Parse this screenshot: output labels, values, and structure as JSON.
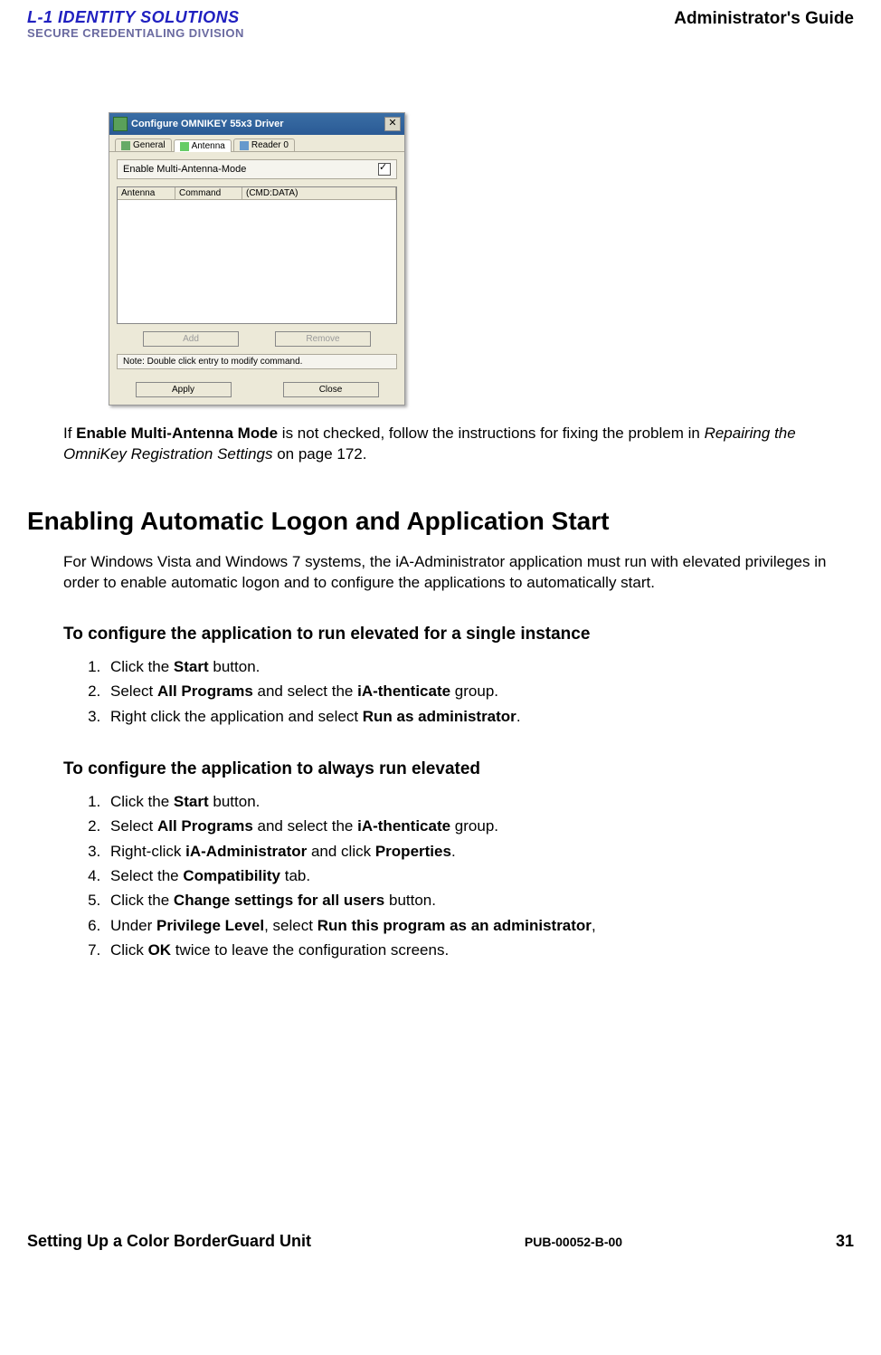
{
  "header": {
    "logo_line1": "L-1 IDENTITY SOLUTIONS",
    "logo_line2": "SECURE CREDENTIALING DIVISION",
    "guide_title": "Administrator's Guide"
  },
  "dialog": {
    "title": "Configure OMNIKEY 55x3 Driver",
    "tabs": {
      "general": "General",
      "antenna": "Antenna",
      "reader": "Reader 0"
    },
    "checkbox_label": "Enable Multi-Antenna-Mode",
    "cols": {
      "c1": "Antenna",
      "c2": "Command",
      "c3": "(CMD:DATA)"
    },
    "btn_add": "Add",
    "btn_remove": "Remove",
    "note": "Note: Double click entry to modify command.",
    "btn_apply": "Apply",
    "btn_close": "Close"
  },
  "para1_pre": "If ",
  "para1_bold": "Enable Multi-Antenna Mode",
  "para1_mid": " is not checked, follow the instructions for fixing the problem in ",
  "para1_italic": "Repairing the OmniKey Registration Settings",
  "para1_post": " on page 172.",
  "h1": "Enabling Automatic Logon and Application Start",
  "para2": "For Windows Vista and Windows 7 systems, the iA-Administrator application must run with elevated privileges in order to enable automatic logon and to configure the applications to automatically start.",
  "h2a": "To configure the application to run elevated for a single instance",
  "steps_a": {
    "s1_a": "Click the ",
    "s1_b": "Start",
    "s1_c": " button.",
    "s2_a": "Select ",
    "s2_b": "All Programs",
    "s2_c": " and select the ",
    "s2_d": "iA-thenticate",
    "s2_e": " group.",
    "s3_a": "Right click the application and select ",
    "s3_b": "Run as administrator",
    "s3_c": "."
  },
  "h2b": "To configure the application to always run elevated",
  "steps_b": {
    "s1_a": "Click the ",
    "s1_b": "Start",
    "s1_c": " button.",
    "s2_a": "Select ",
    "s2_b": "All Programs",
    "s2_c": " and select the ",
    "s2_d": "iA-thenticate",
    "s2_e": " group.",
    "s3_a": " Right-click ",
    "s3_b": "iA-Administrator",
    "s3_c": " and click ",
    "s3_d": "Properties",
    "s3_e": ".",
    "s4_a": "Select the ",
    "s4_b": "Compatibility",
    "s4_c": " tab.",
    "s5_a": "Click the ",
    "s5_b": "Change settings for all users",
    "s5_c": " button.",
    "s6_a": "Under ",
    "s6_b": "Privilege Level",
    "s6_c": ", select ",
    "s6_d": "Run this program as an administrator",
    "s6_e": ",",
    "s7_a": "Click ",
    "s7_b": "OK",
    "s7_c": " twice to leave the configuration screens."
  },
  "footer": {
    "left": "Setting Up a Color BorderGuard Unit",
    "center": "PUB-00052-B-00",
    "right": "31"
  }
}
